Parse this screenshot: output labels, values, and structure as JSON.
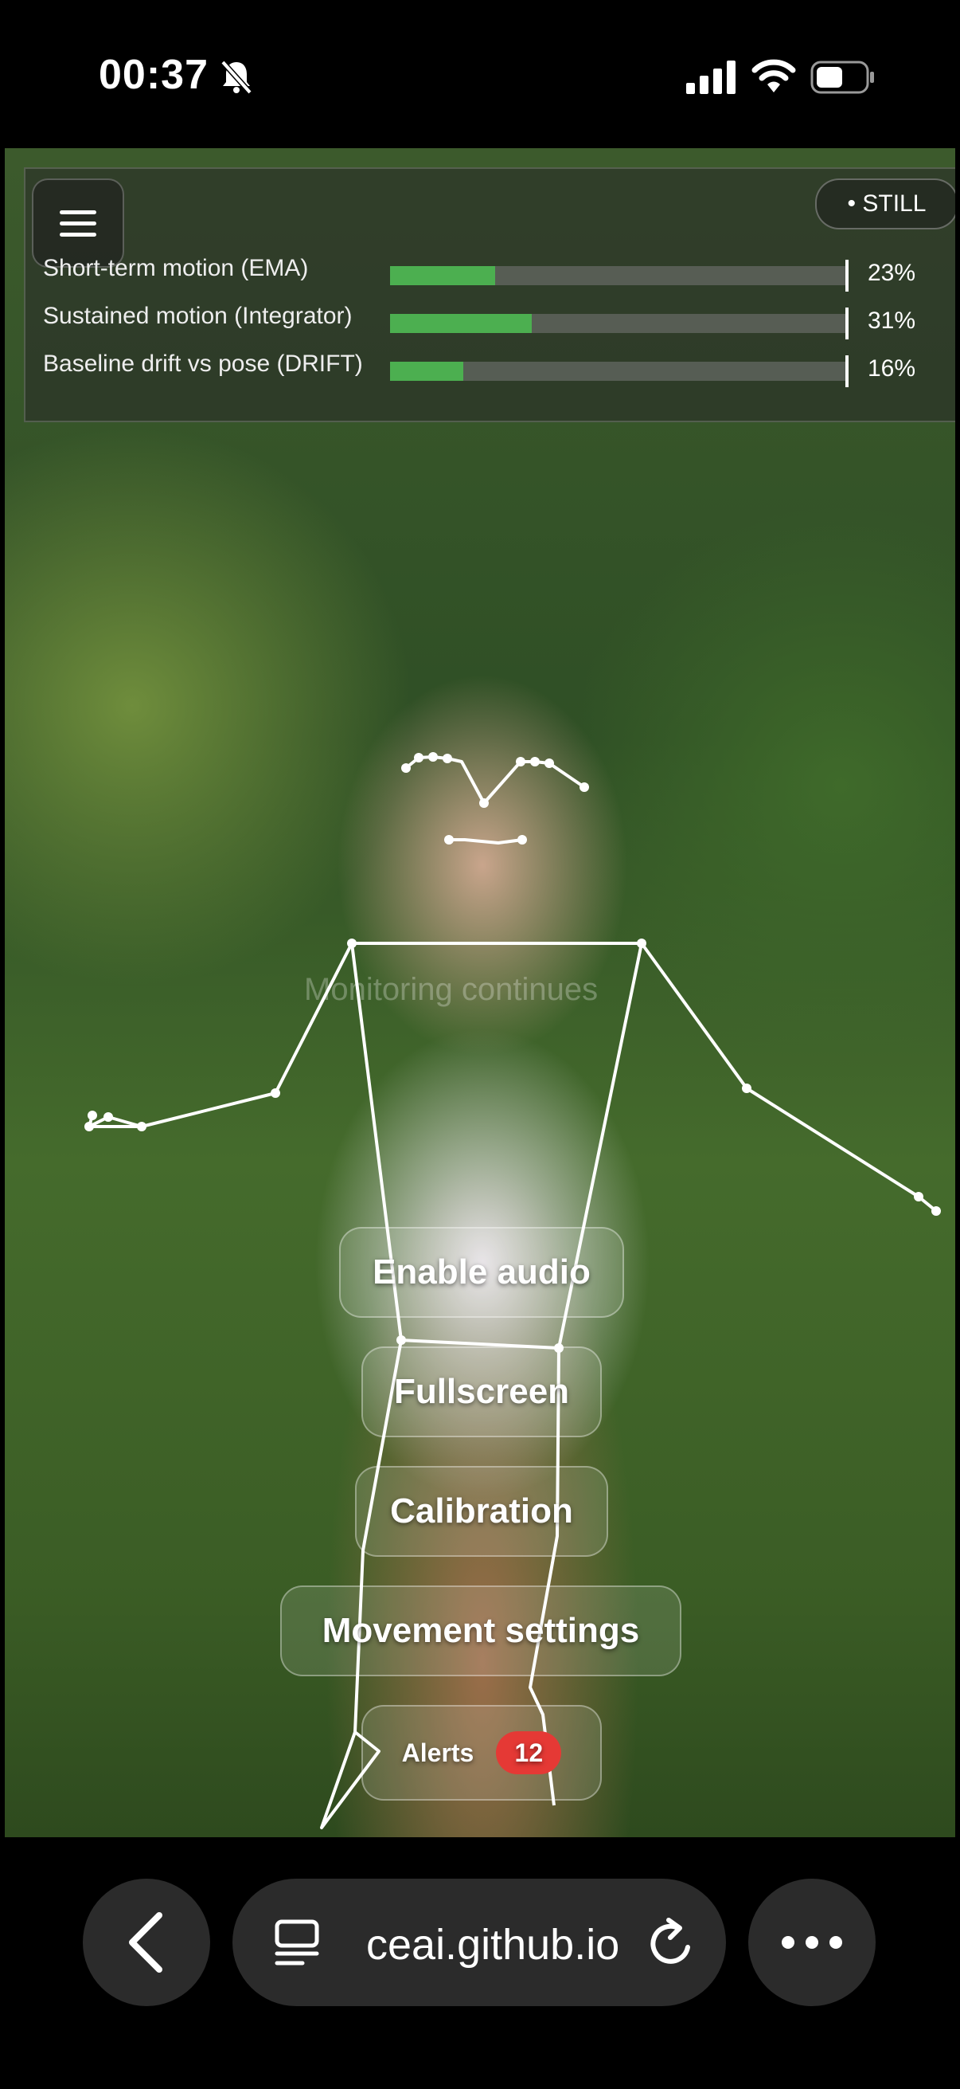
{
  "status_bar": {
    "time": "00:37",
    "icons": [
      "bell-slash-icon",
      "signal-icon",
      "wifi-icon",
      "battery-icon"
    ]
  },
  "monitor_panel": {
    "state": "• STILL",
    "metrics": [
      {
        "label": "Short-term motion (EMA)",
        "value": "23%",
        "fraction": 0.23
      },
      {
        "label": "Sustained motion (Integrator)",
        "value": "31%",
        "fraction": 0.31
      },
      {
        "label": "Baseline drift vs pose (DRIFT)",
        "value": "16%",
        "fraction": 0.16
      }
    ],
    "accent_color": "#4caf50"
  },
  "overlay": {
    "ghost_text": "Monitoring continues"
  },
  "actions": {
    "enable_audio": "Enable audio",
    "fullscreen": "Fullscreen",
    "calibration": "Calibration",
    "movement_settings": "Movement settings",
    "alerts": "Alerts",
    "alerts_count": "12",
    "badge_color": "#e53935"
  },
  "browser": {
    "url": "ceai.github.io",
    "icons": [
      "back-icon",
      "tabs-icon",
      "reload-icon",
      "more-icon"
    ]
  }
}
